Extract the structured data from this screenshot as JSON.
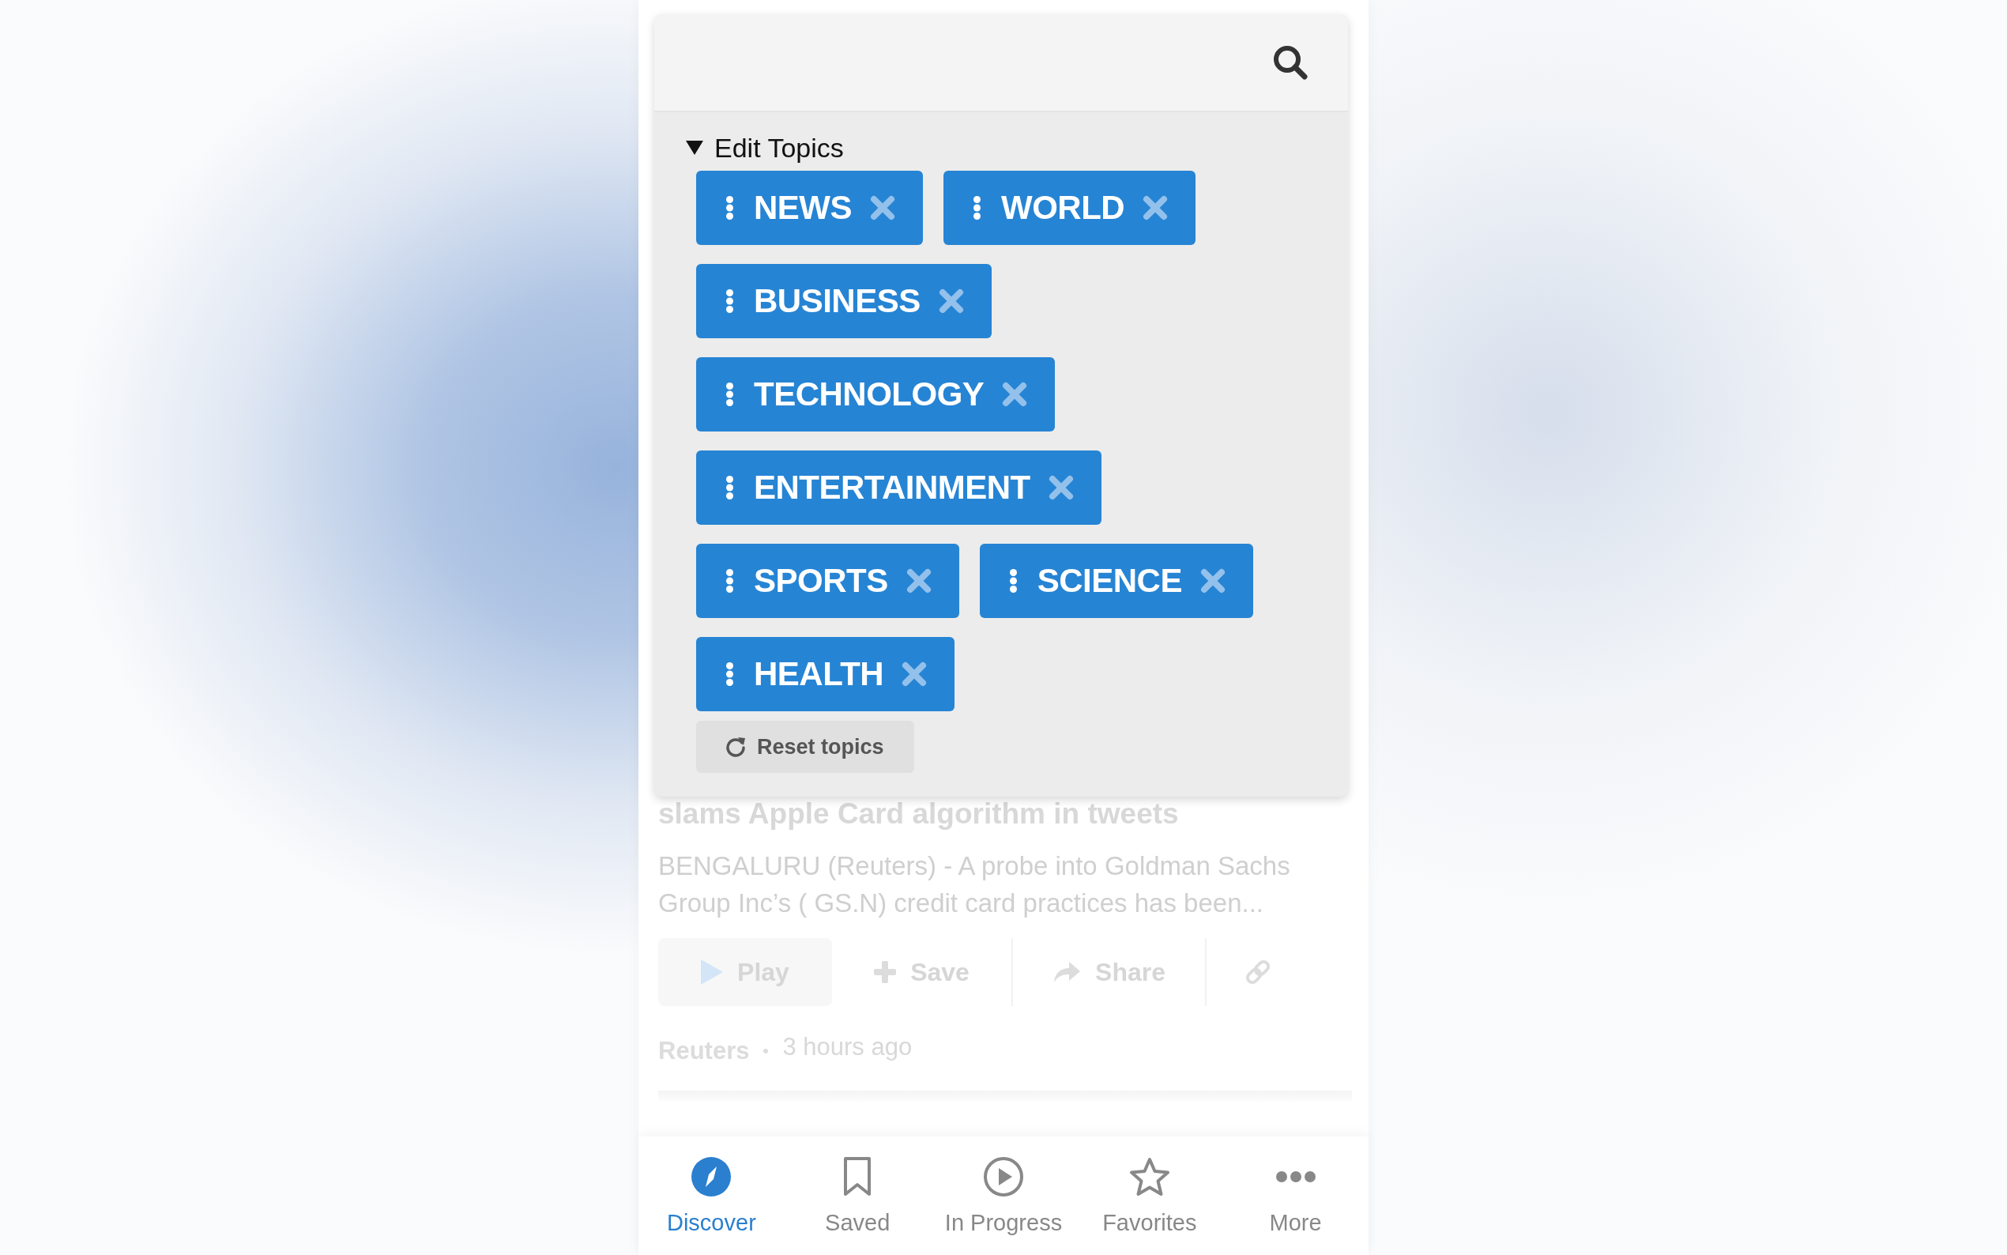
{
  "topics_panel": {
    "title": "Edit Topics",
    "expanded": true,
    "topics": [
      {
        "label": "NEWS"
      },
      {
        "label": "WORLD"
      },
      {
        "label": "BUSINESS"
      },
      {
        "label": "TECHNOLOGY"
      },
      {
        "label": "ENTERTAINMENT"
      },
      {
        "label": "SPORTS"
      },
      {
        "label": "SCIENCE"
      },
      {
        "label": "HEALTH"
      }
    ],
    "reset_button": "Reset topics"
  },
  "article": {
    "title": "slams Apple Card algorithm in tweets",
    "summary": "BENGALURU (Reuters) - A probe into Goldman Sachs Group Inc’s ( GS.N) credit card practices has been...",
    "actions": [
      {
        "kind": "play",
        "label": "Play"
      },
      {
        "kind": "save",
        "label": "Save"
      },
      {
        "kind": "share",
        "label": "Share"
      },
      {
        "kind": "link"
      }
    ],
    "source": "Reuters",
    "time": "3 hours ago"
  },
  "tab_bar": [
    {
      "kind": "compass",
      "label": "Discover",
      "selected": true
    },
    {
      "kind": "bookmark",
      "label": "Saved",
      "selected": false
    },
    {
      "kind": "play",
      "label": "In Progress",
      "selected": false
    },
    {
      "kind": "star",
      "label": "Favorites",
      "selected": false
    },
    {
      "kind": "more",
      "label": "More",
      "selected": false
    }
  ]
}
